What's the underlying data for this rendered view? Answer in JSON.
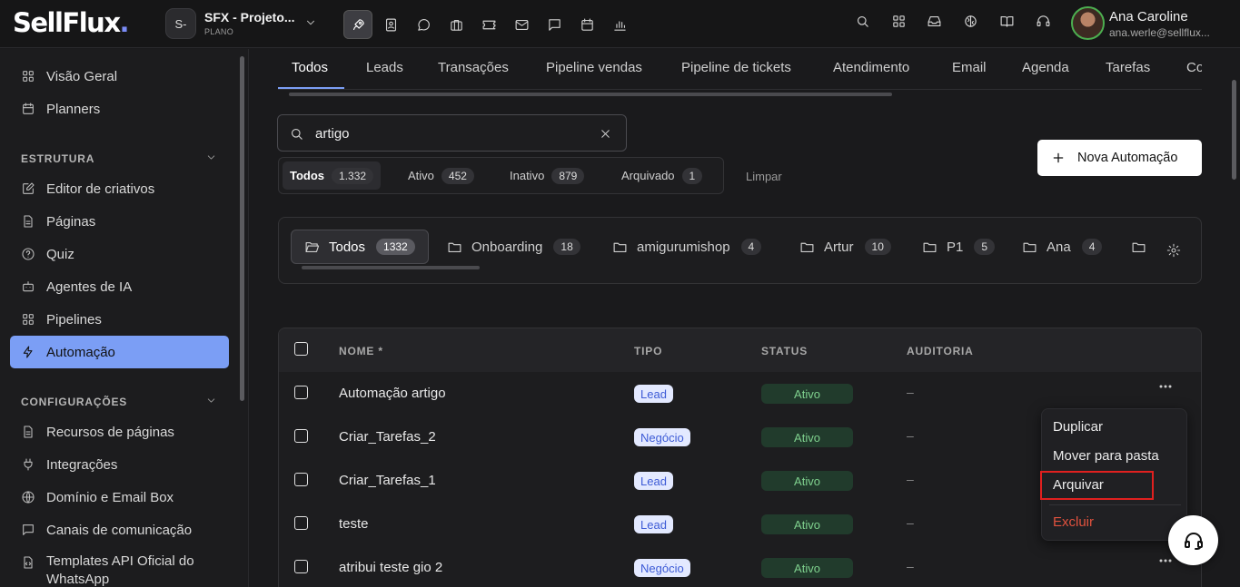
{
  "brand": {
    "logo_text": "SellFlux",
    "logo_dot": "."
  },
  "project": {
    "avatar": "S-",
    "name": "SFX - Projeto...",
    "plan": "PLANO"
  },
  "user": {
    "name": "Ana Caroline",
    "email": "ana.werle@sellflux..."
  },
  "sidebar": {
    "items_top": [
      {
        "label": "Visão Geral",
        "icon": "grid-icon"
      },
      {
        "label": "Planners",
        "icon": "calendar-icon"
      }
    ],
    "sections": [
      {
        "title": "ESTRUTURA",
        "items": [
          {
            "label": "Editor de criativos",
            "icon": "edit-icon"
          },
          {
            "label": "Páginas",
            "icon": "page-icon"
          },
          {
            "label": "Quiz",
            "icon": "help-circle-icon"
          },
          {
            "label": "Agentes de IA",
            "icon": "bot-icon"
          },
          {
            "label": "Pipelines",
            "icon": "grid-icon"
          },
          {
            "label": "Automação",
            "icon": "bolt-icon",
            "active": true
          }
        ]
      },
      {
        "title": "CONFIGURAÇÕES",
        "items": [
          {
            "label": "Recursos de páginas",
            "icon": "page-icon"
          },
          {
            "label": "Integrações",
            "icon": "plug-icon"
          },
          {
            "label": "Domínio e Email Box",
            "icon": "globe-icon"
          },
          {
            "label": "Canais de comunicação",
            "icon": "chat-icon"
          },
          {
            "label": "Templates API Oficial do WhatsApp",
            "icon": "code-file-icon"
          }
        ]
      }
    ]
  },
  "tabs": [
    "Todos",
    "Leads",
    "Transações",
    "Pipeline vendas",
    "Pipeline de tickets",
    "Atendimento",
    "Email",
    "Agenda",
    "Tarefas",
    "Co"
  ],
  "search": {
    "value": "artigo"
  },
  "filters": [
    {
      "label": "Todos",
      "count": "1.332",
      "active": true
    },
    {
      "label": "Ativo",
      "count": "452"
    },
    {
      "label": "Inativo",
      "count": "879"
    },
    {
      "label": "Arquivado",
      "count": "1"
    }
  ],
  "clear_label": "Limpar",
  "new_button": "Nova Automação",
  "folders": [
    {
      "label": "Todos",
      "count": "1332",
      "active": true
    },
    {
      "label": "Onboarding",
      "count": "18"
    },
    {
      "label": "amigurumishop",
      "count": "4"
    },
    {
      "label": "Artur",
      "count": "10"
    },
    {
      "label": "P1",
      "count": "5"
    },
    {
      "label": "Ana",
      "count": "4"
    }
  ],
  "table": {
    "headers": {
      "name": "NOME *",
      "type": "TIPO",
      "status": "STATUS",
      "audit": "AUDITORIA"
    },
    "rows": [
      {
        "name": "Automação artigo",
        "type": "Lead",
        "status": "Ativo",
        "audit": "–"
      },
      {
        "name": "Criar_Tarefas_2",
        "type": "Negócio",
        "status": "Ativo",
        "audit": "–"
      },
      {
        "name": "Criar_Tarefas_1",
        "type": "Lead",
        "status": "Ativo",
        "audit": "–"
      },
      {
        "name": "teste",
        "type": "Lead",
        "status": "Ativo",
        "audit": "–"
      },
      {
        "name": "atribui teste gio 2",
        "type": "Negócio",
        "status": "Ativo",
        "audit": "–"
      }
    ]
  },
  "row_menu": {
    "items": [
      "Duplicar",
      "Mover para pasta",
      "Arquivar"
    ],
    "danger": "Excluir"
  },
  "colors": {
    "accent": "#7b9ef5",
    "danger": "#e0523e",
    "status_bg": "#213b2c",
    "status_fg": "#7fd18e"
  }
}
